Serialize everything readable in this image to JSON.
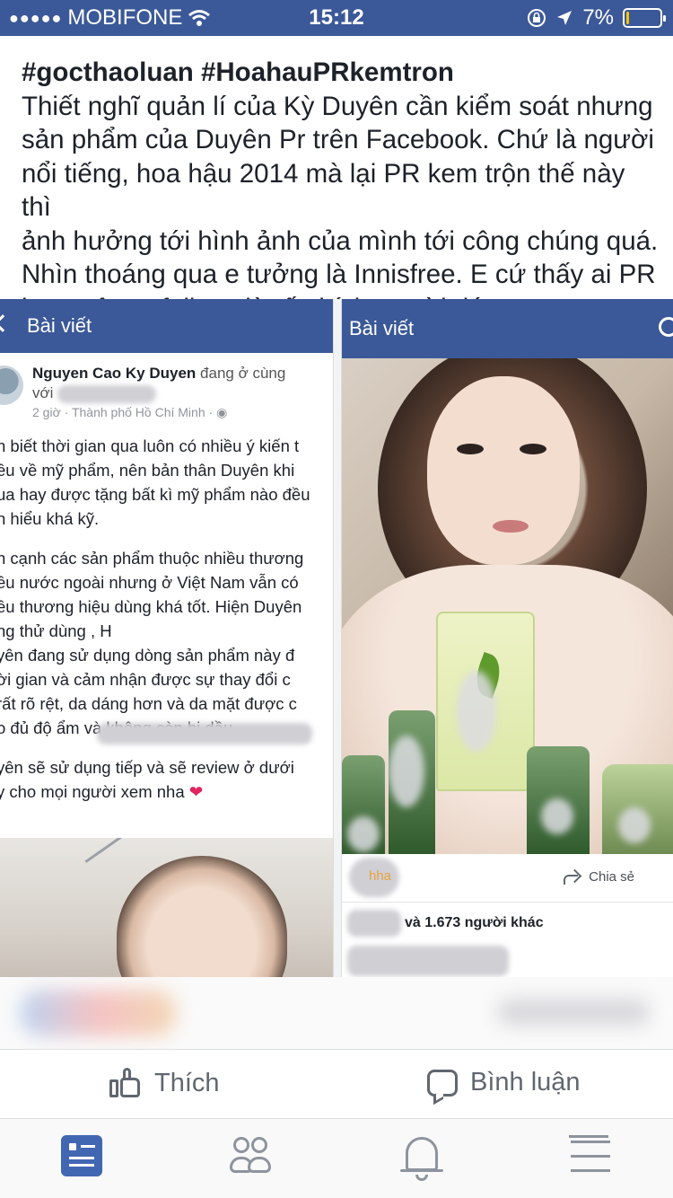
{
  "status_bar": {
    "signal_dots": "●●●●●",
    "carrier": "MOBIFONE",
    "time": "15:12",
    "battery_percent": "7%",
    "battery_level": 0.07,
    "accent_color": "#3b5998"
  },
  "post": {
    "hashtags": "#gocthaoluan #HoahauPRkemtron",
    "body": "Thiết nghĩ quản lí của Kỳ Duyên cần kiểm soát nhưng\nsản phẩm của Duyên Pr trên Facebook. Chứ là người\nnổi tiếng,  hoa hậu 2014 mà lại PR kem trộn thế này thì\nảnh hưởng tới hình ảnh của mình tới công chúng quá.\nNhìn thoáng qua e tưởng là Innisfree. E cứ thấy ai PR\nkem trộn unfollow dù rất thích người đó."
  },
  "left_screenshot": {
    "header_title": "Bài viết",
    "author_name": "Nguyen Cao Ky Duyen",
    "author_suffix": " đang ở cùng",
    "with_label": "với",
    "time": "2 giờ",
    "location": "Thành phố Hồ Chí Minh",
    "paragraphs": [
      "n biết thời gian qua luôn có nhiều ý kiến t\nều về mỹ phẩm, nên bản thân Duyên khi\nua hay được tặng bất kì mỹ phẩm nào đều\nn hiểu khá kỹ.",
      "n cạnh các sản phẩm thuộc nhiều thương\nều nước ngoài nhưng ở Việt Nam vẫn có\nều thương hiệu dùng khá tốt. Hiện Duyên\nng thử dùng                                  , H\nyên đang sử dụng dòng sản phẩm này đ\nời gian và cảm nhận được sự thay đổi c\nrất rõ rệt, da dáng hơn và da mặt được c\no đủ độ ẩm và không còn bị dầu",
      "yên sẽ sử dụng tiếp và sẽ review ở dưới\ny cho mọi người xem nha"
    ],
    "heart": "❤"
  },
  "right_screenshot": {
    "header_title": "Bài viết",
    "like_partial": "hha",
    "share_label": "Chia sẻ",
    "reactions_text": "và 1.673 người khác"
  },
  "actions": {
    "like_label": "Thích",
    "comment_label": "Bình luận"
  },
  "tabbar": {
    "items": [
      {
        "icon": "news-feed-icon",
        "active": true
      },
      {
        "icon": "friends-icon",
        "active": false
      },
      {
        "icon": "notifications-bell-icon",
        "active": false
      },
      {
        "icon": "menu-icon",
        "active": false
      }
    ],
    "active_color": "#4267b2",
    "inactive_color": "#8d949e"
  }
}
